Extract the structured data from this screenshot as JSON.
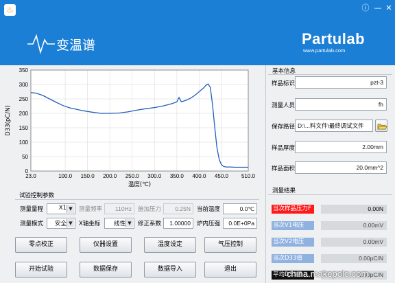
{
  "header": {
    "title": "变温谱",
    "brand": "Partulab",
    "url": "www.partulab.com",
    "colors": {
      "header_bg": "#1b7fd6"
    },
    "window_buttons": [
      "info-icon",
      "minimize-icon",
      "close-icon"
    ]
  },
  "chart_data": {
    "type": "line",
    "xlabel": "温度(℃)",
    "ylabel": "D33(pC/N)",
    "xlim": [
      23.0,
      510.0
    ],
    "ylim": [
      0,
      350
    ],
    "xticks": [
      "23.0",
      "100.0",
      "150.0",
      "200.0",
      "250.0",
      "300.0",
      "350.0",
      "400.0",
      "450.0",
      "510.0"
    ],
    "yticks": [
      "0",
      "50",
      "100",
      "150",
      "200",
      "250",
      "300",
      "350"
    ],
    "grid": true,
    "series": [
      {
        "color": "#1f5fb8",
        "x": [
          23,
          35,
          50,
          65,
          80,
          95,
          110,
          125,
          140,
          160,
          180,
          200,
          220,
          240,
          260,
          280,
          300,
          320,
          340,
          350,
          355,
          360,
          370,
          380,
          390,
          400,
          410,
          415,
          420,
          425,
          430,
          435,
          440,
          445,
          450,
          455,
          460,
          470,
          480,
          490,
          510
        ],
        "y": [
          272,
          270,
          262,
          250,
          238,
          227,
          219,
          214,
          209,
          204,
          200,
          200,
          201,
          205,
          211,
          216,
          220,
          226,
          234,
          240,
          255,
          240,
          245,
          252,
          262,
          275,
          288,
          297,
          302,
          290,
          230,
          150,
          80,
          40,
          22,
          16,
          14,
          14,
          13,
          13,
          13
        ]
      }
    ]
  },
  "controls": {
    "section_title": "试验控制参数",
    "range_label": "测量量程",
    "range_value": "X1",
    "freq_label": "测量频率",
    "freq_value": "110Hz",
    "pressure_label": "施加压力",
    "pressure_value": "0.25N",
    "temp_label": "当前温度",
    "temp_value": "0.0℃",
    "mode_label": "测量模式",
    "mode_value": "安全",
    "xaxis_label": "X轴坐标",
    "xaxis_value": "线性",
    "coef_label": "修正系数",
    "coef_value": "1.00000",
    "furnace_label": "炉内压强",
    "furnace_value": "0.0E+0Pa",
    "buttons": {
      "zero": "零点校正",
      "instrument": "仪器设置",
      "temp_set": "温度设定",
      "pressure_ctrl": "气压控制",
      "start": "开始试验",
      "save": "数据保存",
      "import": "数据导入",
      "exit": "退出"
    }
  },
  "info": {
    "section_title": "基本信息",
    "sample_id_label": "样品标识",
    "sample_id_value": "pzt-3",
    "operator_label": "测量人员",
    "operator_value": "fh",
    "path_label": "保存路径",
    "path_value": "D:\\...料文件\\最终调试文件",
    "thickness_label": "样品厚度",
    "thickness_value": "2.00mm",
    "area_label": "样品面积",
    "area_value": "20.0mm^2"
  },
  "results": {
    "section_title": "测量结果",
    "items": [
      {
        "label": "当次样品压力F",
        "value": "0.00N",
        "label_bg": "#ff1a1a",
        "value_color": "#000000"
      },
      {
        "label": "当次V1电压",
        "value": "0.00mV",
        "label_bg": "#8fb2e0",
        "value_color": "#444444"
      },
      {
        "label": "当次V2电压",
        "value": "0.00mV",
        "label_bg": "#8fb2e0",
        "value_color": "#444444"
      },
      {
        "label": "当次D33值",
        "value": "0.00pC/N",
        "label_bg": "#8fb2e0",
        "value_color": "#444444"
      },
      {
        "label": "平均D33值",
        "value": "0.00pC/N",
        "label_bg": "#111111",
        "value_color": "#444444"
      }
    ]
  },
  "watermark": "china.makepolo.com"
}
